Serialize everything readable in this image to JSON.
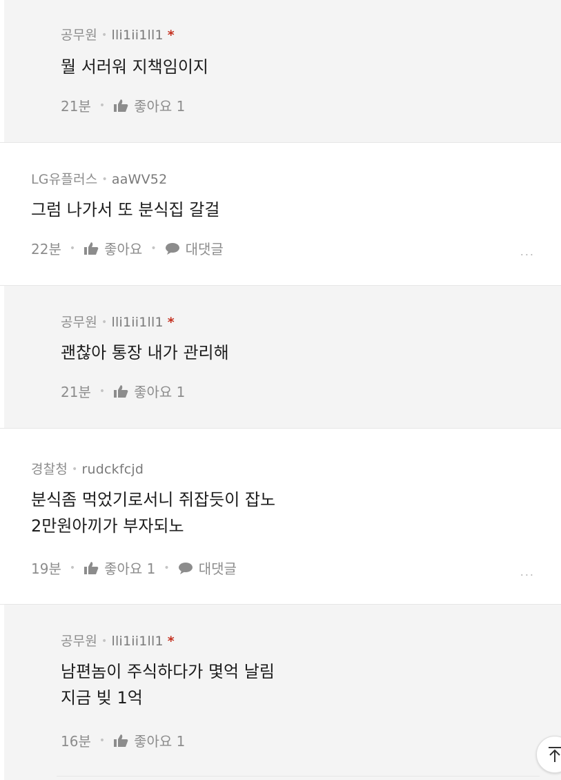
{
  "comments": [
    {
      "org": "공무원",
      "user": "lli1ii1ll1",
      "star": "*",
      "lines": [
        "뭘 서러워 지책임이지"
      ],
      "time": "21분",
      "like_label": "좋아요 1"
    },
    {
      "org": "LG유플러스",
      "user": "aaWV52",
      "lines": [
        "그럼 나가서 또 분식집 갈걸"
      ],
      "time": "22분",
      "like_label": "좋아요",
      "reply_label": "대댓글",
      "more": "..."
    },
    {
      "org": "공무원",
      "user": "lli1ii1ll1",
      "star": "*",
      "lines": [
        "괜찮아 통장 내가 관리해"
      ],
      "time": "21분",
      "like_label": "좋아요 1"
    },
    {
      "org": "경찰청",
      "user": "rudckfcjd",
      "lines": [
        "분식좀 먹었기로서니 쥐잡듯이 잡노",
        "2만원아끼가 부자되노"
      ],
      "time": "19분",
      "like_label": "좋아요 1",
      "reply_label": "대댓글",
      "more": "..."
    },
    {
      "org": "공무원",
      "user": "lli1ii1ll1",
      "star": "*",
      "lines": [
        "남편놈이 주식하다가 몇억 날림",
        "지금 빚 1억"
      ],
      "time": "16분",
      "like_label": "좋아요 1"
    }
  ],
  "scroll_top": {
    "icon": "arrow-up-to-top-icon",
    "glyph": "↑"
  },
  "colors": {
    "reply_bg": "#f4f4f4",
    "star": "#c4301f",
    "meta": "#8c8c8c"
  }
}
